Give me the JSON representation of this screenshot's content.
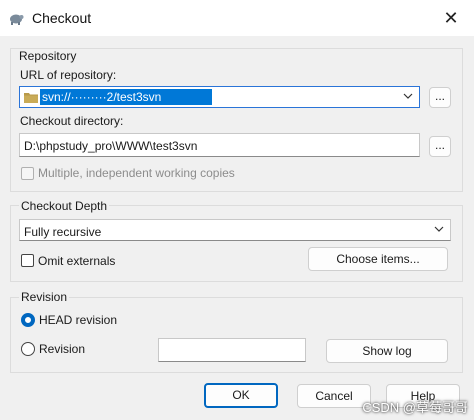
{
  "window": {
    "title": "Checkout",
    "close_glyph": "✕"
  },
  "repository": {
    "group_label": "Repository",
    "url_label": "URL of repository:",
    "url_value": "svn://·········2/test3svn",
    "browse_label": "...",
    "dir_label": "Checkout directory:",
    "dir_value": "D:\\phpstudy_pro\\WWW\\test3svn",
    "dir_browse_label": "...",
    "multiple_wc_label": "Multiple, independent working copies"
  },
  "depth": {
    "group_label": "Checkout Depth",
    "selected": "Fully recursive",
    "omit_externals_label": "Omit externals",
    "choose_items_label": "Choose items..."
  },
  "revision": {
    "group_label": "Revision",
    "head_label": "HEAD revision",
    "revision_label": "Revision",
    "revision_value": "",
    "show_log_label": "Show log"
  },
  "footer": {
    "ok_label": "OK",
    "cancel_label": "Cancel",
    "help_label": "Help"
  },
  "watermark": "CSDN @草莓哥哥",
  "colors": {
    "accent": "#0067c0",
    "selection": "#0078d7"
  },
  "icons": [
    "tortoise-app-icon",
    "close-icon",
    "folder-icon",
    "chevron-down-icon"
  ]
}
